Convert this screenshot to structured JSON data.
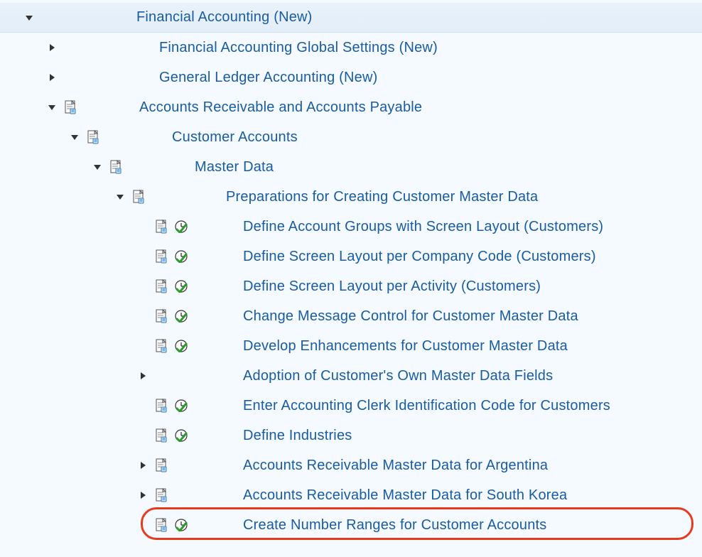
{
  "tree": {
    "root": {
      "label": "Financial Accounting (New)",
      "expanded": true
    },
    "level1": [
      {
        "label": "Financial Accounting Global Settings (New)",
        "expanded": false,
        "hasDoc": false
      },
      {
        "label": "General Ledger Accounting (New)",
        "expanded": false,
        "hasDoc": false
      },
      {
        "label": "Accounts Receivable and Accounts Payable",
        "expanded": true,
        "hasDoc": true
      }
    ],
    "level2": {
      "label": "Customer Accounts",
      "expanded": true,
      "hasDoc": true
    },
    "level3": {
      "label": "Master Data",
      "expanded": true,
      "hasDoc": true
    },
    "level4": {
      "label": "Preparations for Creating Customer Master Data",
      "expanded": true,
      "hasDoc": true
    },
    "leaves": [
      {
        "label": "Define Account Groups with Screen Layout (Customers)",
        "hasDoc": true,
        "hasClock": true,
        "arrow": "none"
      },
      {
        "label": "Define Screen Layout per Company Code (Customers)",
        "hasDoc": true,
        "hasClock": true,
        "arrow": "none"
      },
      {
        "label": "Define Screen Layout per Activity (Customers)",
        "hasDoc": true,
        "hasClock": true,
        "arrow": "none"
      },
      {
        "label": "Change Message Control for Customer Master Data",
        "hasDoc": true,
        "hasClock": true,
        "arrow": "none"
      },
      {
        "label": "Develop Enhancements for Customer Master Data",
        "hasDoc": true,
        "hasClock": true,
        "arrow": "none"
      },
      {
        "label": "Adoption of Customer's Own Master Data Fields",
        "hasDoc": false,
        "hasClock": false,
        "arrow": "collapsed"
      },
      {
        "label": "Enter Accounting Clerk Identification Code for Customers",
        "hasDoc": true,
        "hasClock": true,
        "arrow": "none"
      },
      {
        "label": "Define Industries",
        "hasDoc": true,
        "hasClock": true,
        "arrow": "none"
      },
      {
        "label": "Accounts Receivable Master Data for Argentina",
        "hasDoc": true,
        "hasClock": false,
        "arrow": "collapsed"
      },
      {
        "label": "Accounts Receivable Master Data for South Korea",
        "hasDoc": true,
        "hasClock": false,
        "arrow": "collapsed"
      },
      {
        "label": "Create Number Ranges for Customer Accounts",
        "hasDoc": true,
        "hasClock": true,
        "arrow": "none",
        "highlighted": true
      }
    ]
  }
}
